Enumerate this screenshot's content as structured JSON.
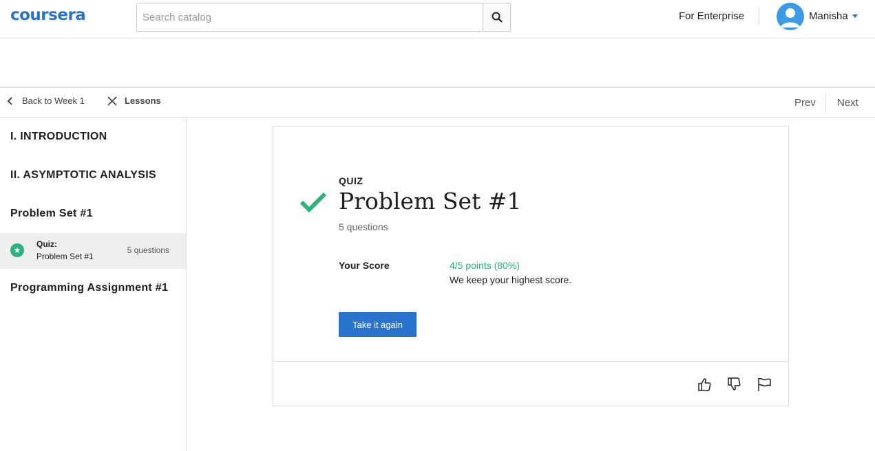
{
  "header": {
    "logo": "coursera",
    "search_placeholder": "Search catalog",
    "enterprise_link": "For Enterprise",
    "user_name": "Manisha"
  },
  "subnav": {
    "back_label": "Back to Week 1",
    "lessons_label": "Lessons",
    "prev_label": "Prev",
    "next_label": "Next"
  },
  "sidebar": {
    "sections": [
      "I. INTRODUCTION",
      "II. ASYMPTOTIC ANALYSIS",
      "Problem Set #1",
      "Programming Assignment #1"
    ],
    "selected_item": {
      "type": "Quiz:",
      "name": "Problem Set #1",
      "count": "5 questions"
    }
  },
  "quiz": {
    "label": "QUIZ",
    "title": "Problem Set #1",
    "question_count": "5 questions",
    "score_label": "Your Score",
    "score_value": "4/5 points (80%)",
    "score_note": "We keep your highest score.",
    "retake_label": "Take it again"
  },
  "colors": {
    "brand_blue": "#2a73cc",
    "success_green": "#2cb27a",
    "avatar_blue": "#3d9ae6"
  }
}
